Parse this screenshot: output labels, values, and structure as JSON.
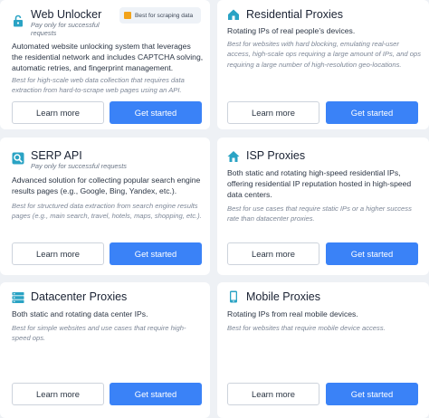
{
  "cards": {
    "web_unlocker": {
      "title": "Web Unlocker",
      "subtitle": "Pay only for successful requests",
      "badge": "Best for scraping data",
      "description": "Automated website unlocking system that leverages the residential network and includes CAPTCHA solving, automatic retries, and fingerprint management.",
      "best_for": "Best for high-scale web data collection that requires data extraction from hard-to-scrape web pages using an API.",
      "learn_more": "Learn more",
      "get_started": "Get started",
      "icon": "lock-icon"
    },
    "residential": {
      "title": "Residential Proxies",
      "description": "Rotating IPs of real people’s devices.",
      "best_for": "Best for websites with hard blocking, emulating real-user access, high-scale ops requiring a large amount of IPs, and ops requiring a large number of high-resolution geo-locations.",
      "learn_more": "Learn more",
      "get_started": "Get started",
      "icon": "home-icon"
    },
    "serp": {
      "title": "SERP API",
      "subtitle": "Pay only for successful requests",
      "description": "Advanced solution for collecting popular search engine results pages (e.g., Google, Bing, Yandex, etc.).",
      "best_for": "Best for structured data extraction from search engine results pages (e.g., main search, travel, hotels, maps, shopping, etc.).",
      "learn_more": "Learn more",
      "get_started": "Get started",
      "icon": "search-icon"
    },
    "isp": {
      "title": "ISP Proxies",
      "description": "Both static and rotating high-speed residential IPs, offering residential IP reputation hosted in high-speed data centers.",
      "best_for": "Best for use cases that require static IPs or a higher success rate than datacenter proxies.",
      "learn_more": "Learn more",
      "get_started": "Get started",
      "icon": "house-icon"
    },
    "datacenter": {
      "title": "Datacenter Proxies",
      "description": "Both static and rotating data center IPs.",
      "best_for": "Best for simple websites and use cases that require high-speed ops.",
      "learn_more": "Learn more",
      "get_started": "Get started",
      "icon": "server-icon"
    },
    "mobile": {
      "title": "Mobile Proxies",
      "description": "Rotating IPs from real mobile devices.",
      "best_for": "Best for websites that require mobile device access.",
      "learn_more": "Learn more",
      "get_started": "Get started",
      "icon": "mobile-phone-icon"
    }
  },
  "colors": {
    "accent": "#3a82f7",
    "icon": "#2aa3c4",
    "background": "#eef1f5"
  }
}
